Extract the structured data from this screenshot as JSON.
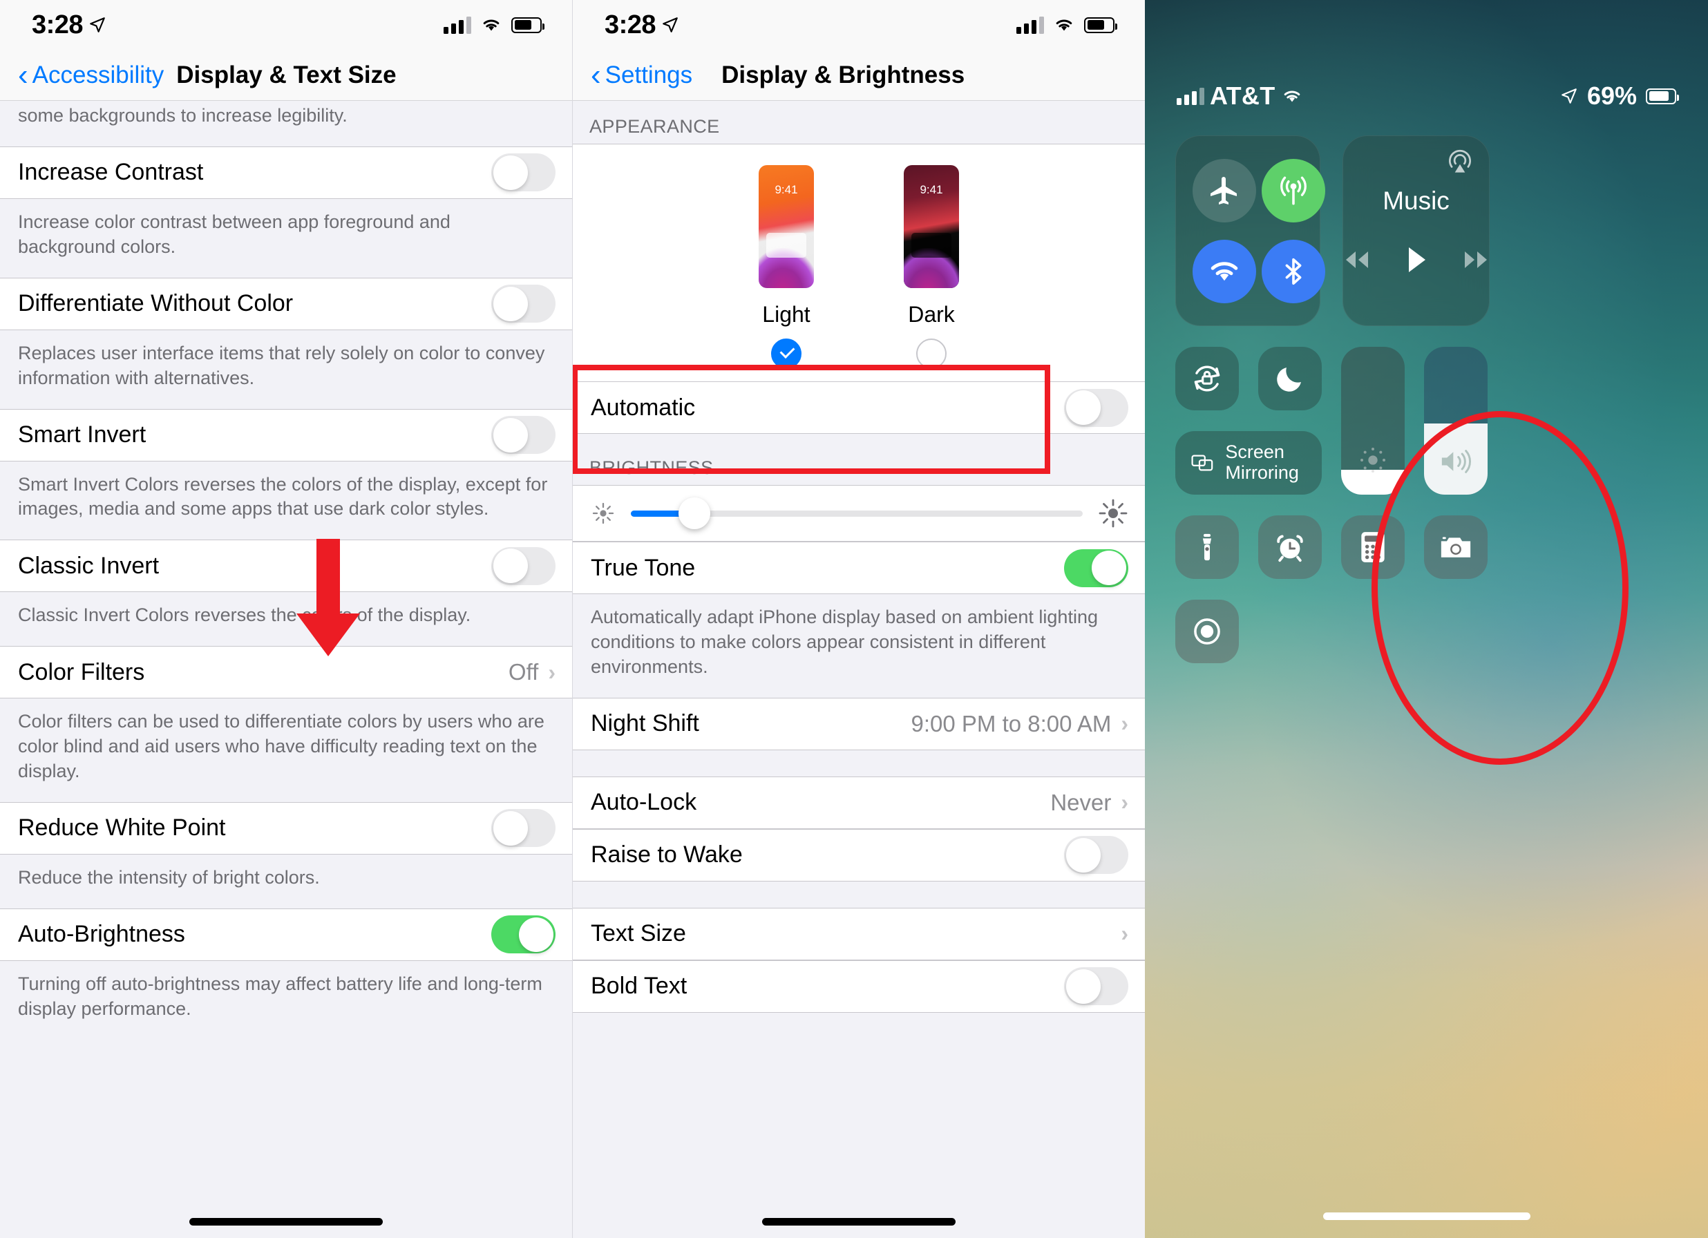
{
  "left_panel": {
    "status_bar": {
      "time": "3:28",
      "location_icon": "location-arrow-icon",
      "signal_icon": "cellular-signal-icon",
      "wifi_icon": "wifi-icon",
      "battery_icon": "battery-icon"
    },
    "nav": {
      "back_label": "Accessibility",
      "title": "Display & Text Size"
    },
    "partial_footnote": "some backgrounds to increase legibility.",
    "rows": [
      {
        "label": "Increase Contrast",
        "type": "toggle",
        "on": false,
        "footnote": "Increase color contrast between app foreground and background colors."
      },
      {
        "label": "Differentiate Without Color",
        "type": "toggle",
        "on": false,
        "footnote": "Replaces user interface items that rely solely on color to convey information with alternatives."
      },
      {
        "label": "Smart Invert",
        "type": "toggle",
        "on": false,
        "footnote": "Smart Invert Colors reverses the colors of the display, except for images, media and some apps that use dark color styles."
      },
      {
        "label": "Classic Invert",
        "type": "toggle",
        "on": false,
        "footnote": "Classic Invert Colors reverses the colors of the display."
      },
      {
        "label": "Color Filters",
        "type": "disclosure",
        "value": "Off",
        "footnote": "Color filters can be used to differentiate colors by users who are color blind and aid users who have difficulty reading text on the display."
      },
      {
        "label": "Reduce White Point",
        "type": "toggle",
        "on": false,
        "footnote": "Reduce the intensity of bright colors."
      },
      {
        "label": "Auto-Brightness",
        "type": "toggle",
        "on": true,
        "footnote": "Turning off auto-brightness may affect battery life and long-term display performance."
      }
    ]
  },
  "mid_panel": {
    "status_bar": {
      "time": "3:28"
    },
    "nav": {
      "back_label": "Settings",
      "title": "Display & Brightness"
    },
    "appearance": {
      "header": "APPEARANCE",
      "options": [
        {
          "label": "Light",
          "preview_time": "9:41",
          "selected": true
        },
        {
          "label": "Dark",
          "preview_time": "9:41",
          "selected": false
        }
      ],
      "automatic_label": "Automatic",
      "automatic_on": false
    },
    "brightness": {
      "header": "BRIGHTNESS",
      "slider_percent": 14,
      "low_icon": "brightness-low-icon",
      "high_icon": "brightness-high-icon",
      "true_tone_label": "True Tone",
      "true_tone_on": true,
      "true_tone_footnote": "Automatically adapt iPhone display based on ambient lighting conditions to make colors appear consistent in different environments."
    },
    "night_shift": {
      "label": "Night Shift",
      "value": "9:00 PM to 8:00 AM"
    },
    "auto_lock": {
      "label": "Auto-Lock",
      "value": "Never"
    },
    "raise_to_wake": {
      "label": "Raise to Wake",
      "on": false
    },
    "text_size": {
      "label": "Text Size"
    },
    "bold_text": {
      "label": "Bold Text",
      "on": false
    },
    "highlight_color": "#ef1c24"
  },
  "right_panel": {
    "status_bar": {
      "carrier": "AT&T",
      "battery_percent": "69%",
      "location_icon": "location-arrow-icon",
      "wifi_icon": "wifi-icon",
      "signal_icon": "cellular-signal-icon"
    },
    "connectivity": [
      {
        "name": "airplane-mode",
        "icon": "airplane-icon",
        "state": "off"
      },
      {
        "name": "cellular-data",
        "icon": "cellular-data-icon",
        "state": "on"
      },
      {
        "name": "wifi",
        "icon": "wifi-icon",
        "state": "on"
      },
      {
        "name": "bluetooth",
        "icon": "bluetooth-icon",
        "state": "on"
      }
    ],
    "music": {
      "title": "Music",
      "airplay_icon": "airplay-audio-icon",
      "controls": [
        "rewind-icon",
        "play-icon",
        "fast-forward-icon"
      ]
    },
    "tiles": [
      {
        "name": "rotation-lock",
        "icon": "rotation-lock-icon"
      },
      {
        "name": "do-not-disturb",
        "icon": "moon-icon"
      },
      {
        "name": "screen-mirroring",
        "icon": "screen-mirroring-icon",
        "label": "Screen Mirroring"
      }
    ],
    "brightness_slider": {
      "name": "brightness-slider",
      "icon": "brightness-icon",
      "fill_percent": 17
    },
    "volume_slider": {
      "name": "volume-slider",
      "icon": "speaker-icon",
      "fill_percent": 48
    },
    "utilities": [
      {
        "name": "flashlight",
        "icon": "flashlight-icon"
      },
      {
        "name": "timer",
        "icon": "alarm-clock-icon"
      },
      {
        "name": "calculator",
        "icon": "calculator-icon"
      },
      {
        "name": "camera",
        "icon": "camera-icon"
      },
      {
        "name": "screen-record",
        "icon": "record-icon"
      }
    ],
    "annotation": {
      "type": "ellipse",
      "color": "#ec1c24",
      "targets": "brightness-slider"
    }
  }
}
